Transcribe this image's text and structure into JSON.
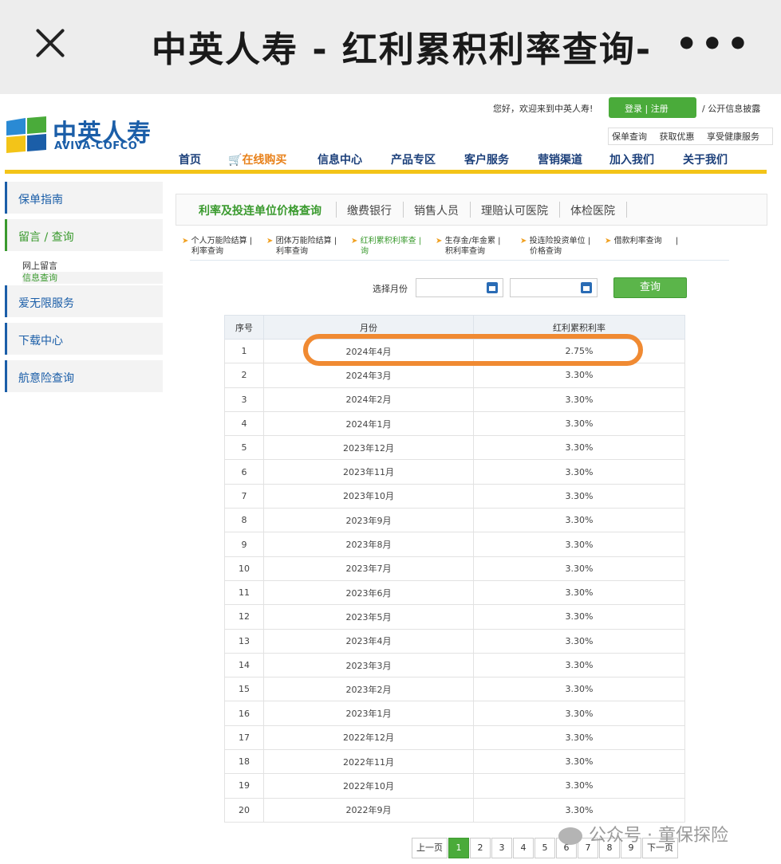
{
  "topbar": {
    "title": "中英人寿 - 红利累积利率查询-",
    "close_icon": "close-icon",
    "more_label": "•••"
  },
  "header": {
    "logo_cn": "中英人寿",
    "logo_en": "AVIVA-COFCO",
    "welcome": "您好，欢迎来到中英人寿!",
    "login": "登录",
    "register": "注册",
    "disclosure": "/ 公开信息披露",
    "services": [
      "保单查询",
      "获取优惠",
      "享受健康服务"
    ]
  },
  "nav": [
    "首页",
    "在线购买",
    "信息中心",
    "产品专区",
    "客户服务",
    "营销渠道",
    "加入我们",
    "关于我们"
  ],
  "sidebar": {
    "items": [
      "保单指南",
      "留言 / 查询",
      "爱无限服务",
      "下载中心",
      "航意险查询"
    ],
    "sub_items": [
      "网上留言",
      "信息查询"
    ]
  },
  "tabs": [
    "利率及投连单位价格查询",
    "缴费银行",
    "销售人员",
    "理赔认可医院",
    "体检医院"
  ],
  "sublinks": [
    {
      "l1": "个人万能险结算",
      "l2": "利率查询"
    },
    {
      "l1": "团体万能险结算",
      "l2": "利率查询"
    },
    {
      "l1": "红利累积利率查",
      "l2": "询"
    },
    {
      "l1": "生存金/年金累",
      "l2": "积利率查询"
    },
    {
      "l1": "投连险投资单位",
      "l2": "价格查询"
    },
    {
      "l1": "借款利率查询",
      "l2": ""
    }
  ],
  "search": {
    "month_label": "选择月份",
    "query_button": "查询"
  },
  "table": {
    "headers": [
      "序号",
      "月份",
      "红利累积利率"
    ],
    "rows": [
      [
        "1",
        "2024年4月",
        "2.75%"
      ],
      [
        "2",
        "2024年3月",
        "3.30%"
      ],
      [
        "3",
        "2024年2月",
        "3.30%"
      ],
      [
        "4",
        "2024年1月",
        "3.30%"
      ],
      [
        "5",
        "2023年12月",
        "3.30%"
      ],
      [
        "6",
        "2023年11月",
        "3.30%"
      ],
      [
        "7",
        "2023年10月",
        "3.30%"
      ],
      [
        "8",
        "2023年9月",
        "3.30%"
      ],
      [
        "9",
        "2023年8月",
        "3.30%"
      ],
      [
        "10",
        "2023年7月",
        "3.30%"
      ],
      [
        "11",
        "2023年6月",
        "3.30%"
      ],
      [
        "12",
        "2023年5月",
        "3.30%"
      ],
      [
        "13",
        "2023年4月",
        "3.30%"
      ],
      [
        "14",
        "2023年3月",
        "3.30%"
      ],
      [
        "15",
        "2023年2月",
        "3.30%"
      ],
      [
        "16",
        "2023年1月",
        "3.30%"
      ],
      [
        "17",
        "2022年12月",
        "3.30%"
      ],
      [
        "18",
        "2022年11月",
        "3.30%"
      ],
      [
        "19",
        "2022年10月",
        "3.30%"
      ],
      [
        "20",
        "2022年9月",
        "3.30%"
      ]
    ]
  },
  "pager": {
    "prev": "上一页",
    "pages": [
      "1",
      "2",
      "3",
      "4",
      "5",
      "6",
      "7",
      "8",
      "9"
    ],
    "current": "1",
    "next": "下一页"
  },
  "watermark": "公众号 · 童保探险",
  "colors": {
    "brand_blue": "#1b5ea8",
    "brand_green": "#4aab3a",
    "highlight_orange": "#f08a32",
    "accent_yellow": "#f3c418"
  }
}
